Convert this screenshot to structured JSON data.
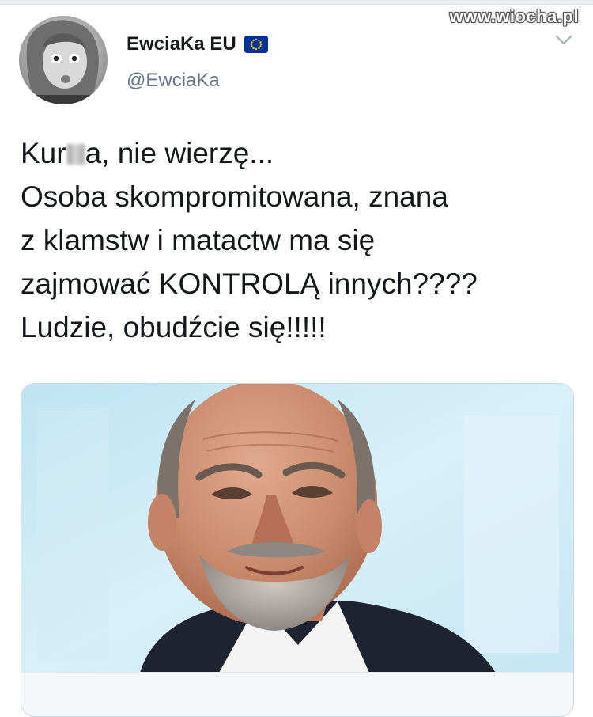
{
  "watermark": "www.wiocha.pl",
  "author": {
    "name": "EwciaKa EU",
    "handle": "@EwciaKa",
    "avatar_icon": "profile-photo",
    "badge_icon": "eu-flag-icon"
  },
  "tweet": {
    "lines": [
      {
        "pre": "Kur",
        "post": "a, nie wierzę..."
      },
      "Osoba skompromitowana, znana",
      "z klamstw i matactw ma się",
      "zajmować KONTROLĄ innych????",
      "Ludzie, obudźcie się!!!!!"
    ]
  },
  "media": {
    "icon": "photo-of-man-with-grey-beard"
  },
  "colors": {
    "handle": "#657786",
    "text": "#14171a",
    "photo_background": "#cfe9f4",
    "eu_flag": "#003399",
    "eu_stars": "#ffcc00"
  }
}
